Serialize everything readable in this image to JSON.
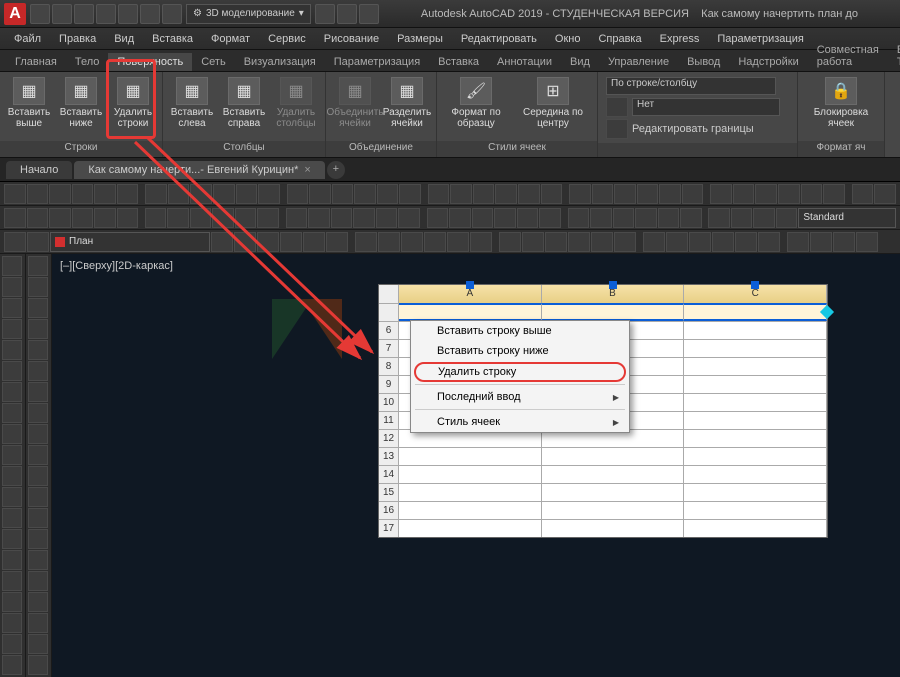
{
  "titlebar": {
    "workspace": "3D моделирование",
    "app": "Autodesk AutoCAD 2019 - СТУДЕНЧЕСКАЯ ВЕРСИЯ",
    "doc_hint": "Как самому начертить план до"
  },
  "menu": [
    "Файл",
    "Правка",
    "Вид",
    "Вставка",
    "Формат",
    "Сервис",
    "Рисование",
    "Размеры",
    "Редактировать",
    "Окно",
    "Справка",
    "Express",
    "Параметризация"
  ],
  "ribbon_tabs": [
    "Главная",
    "Тело",
    "Поверхность",
    "Сеть",
    "Визуализация",
    "Параметризация",
    "Вставка",
    "Аннотации",
    "Вид",
    "Управление",
    "Вывод",
    "Надстройки",
    "Совместная работа",
    "Express Tools"
  ],
  "ribbon_active_index": 2,
  "panels": {
    "rows": {
      "title": "Строки",
      "btns": [
        {
          "label": "Вставить\nвыше",
          "name": "insert-row-above-button"
        },
        {
          "label": "Вставить\nниже",
          "name": "insert-row-below-button"
        },
        {
          "label": "Удалить\nстроки",
          "name": "delete-rows-button"
        }
      ]
    },
    "cols": {
      "title": "Столбцы",
      "btns": [
        {
          "label": "Вставить\nслева",
          "name": "insert-col-left-button"
        },
        {
          "label": "Вставить\nсправа",
          "name": "insert-col-right-button"
        },
        {
          "label": "Удалить\nстолбцы",
          "name": "delete-cols-button",
          "disabled": true
        }
      ]
    },
    "merge": {
      "title": "Объединение",
      "btns": [
        {
          "label": "Объединить\nячейки",
          "name": "merge-cells-button",
          "disabled": true
        },
        {
          "label": "Разделить\nячейки",
          "name": "split-cells-button"
        }
      ]
    },
    "fmt_label": "Формат по образцу",
    "align_label": "Середина по центру",
    "cell_styles": {
      "title": "Стили ячеек",
      "by": "По строке/столбцу",
      "none": "Нет",
      "edit": "Редактировать границы"
    },
    "lock": {
      "title": "Формат яч",
      "label": "Блокировка ячеек"
    }
  },
  "doc_tabs": {
    "start": "Начало",
    "active": "Как самому начерти...- Евгений Курицин*"
  },
  "layer_current": "План",
  "style_combo": "Standard",
  "view_label": "[–][Сверху][2D-каркас]",
  "table": {
    "cols": [
      "A",
      "B",
      "C"
    ],
    "first_visible_row": 6,
    "last_visible_row": 17
  },
  "context_menu": {
    "items": [
      {
        "label": "Вставить строку выше",
        "name": "ctx-insert-row-above"
      },
      {
        "label": "Вставить строку ниже",
        "name": "ctx-insert-row-below"
      },
      {
        "label": "Удалить строку",
        "name": "ctx-delete-row",
        "highlight": true
      },
      {
        "sep": true
      },
      {
        "label": "Последний ввод",
        "name": "ctx-recent-input",
        "sub": true
      },
      {
        "sep": true
      },
      {
        "label": "Стиль ячеек",
        "name": "ctx-cell-style",
        "sub": true
      }
    ]
  }
}
